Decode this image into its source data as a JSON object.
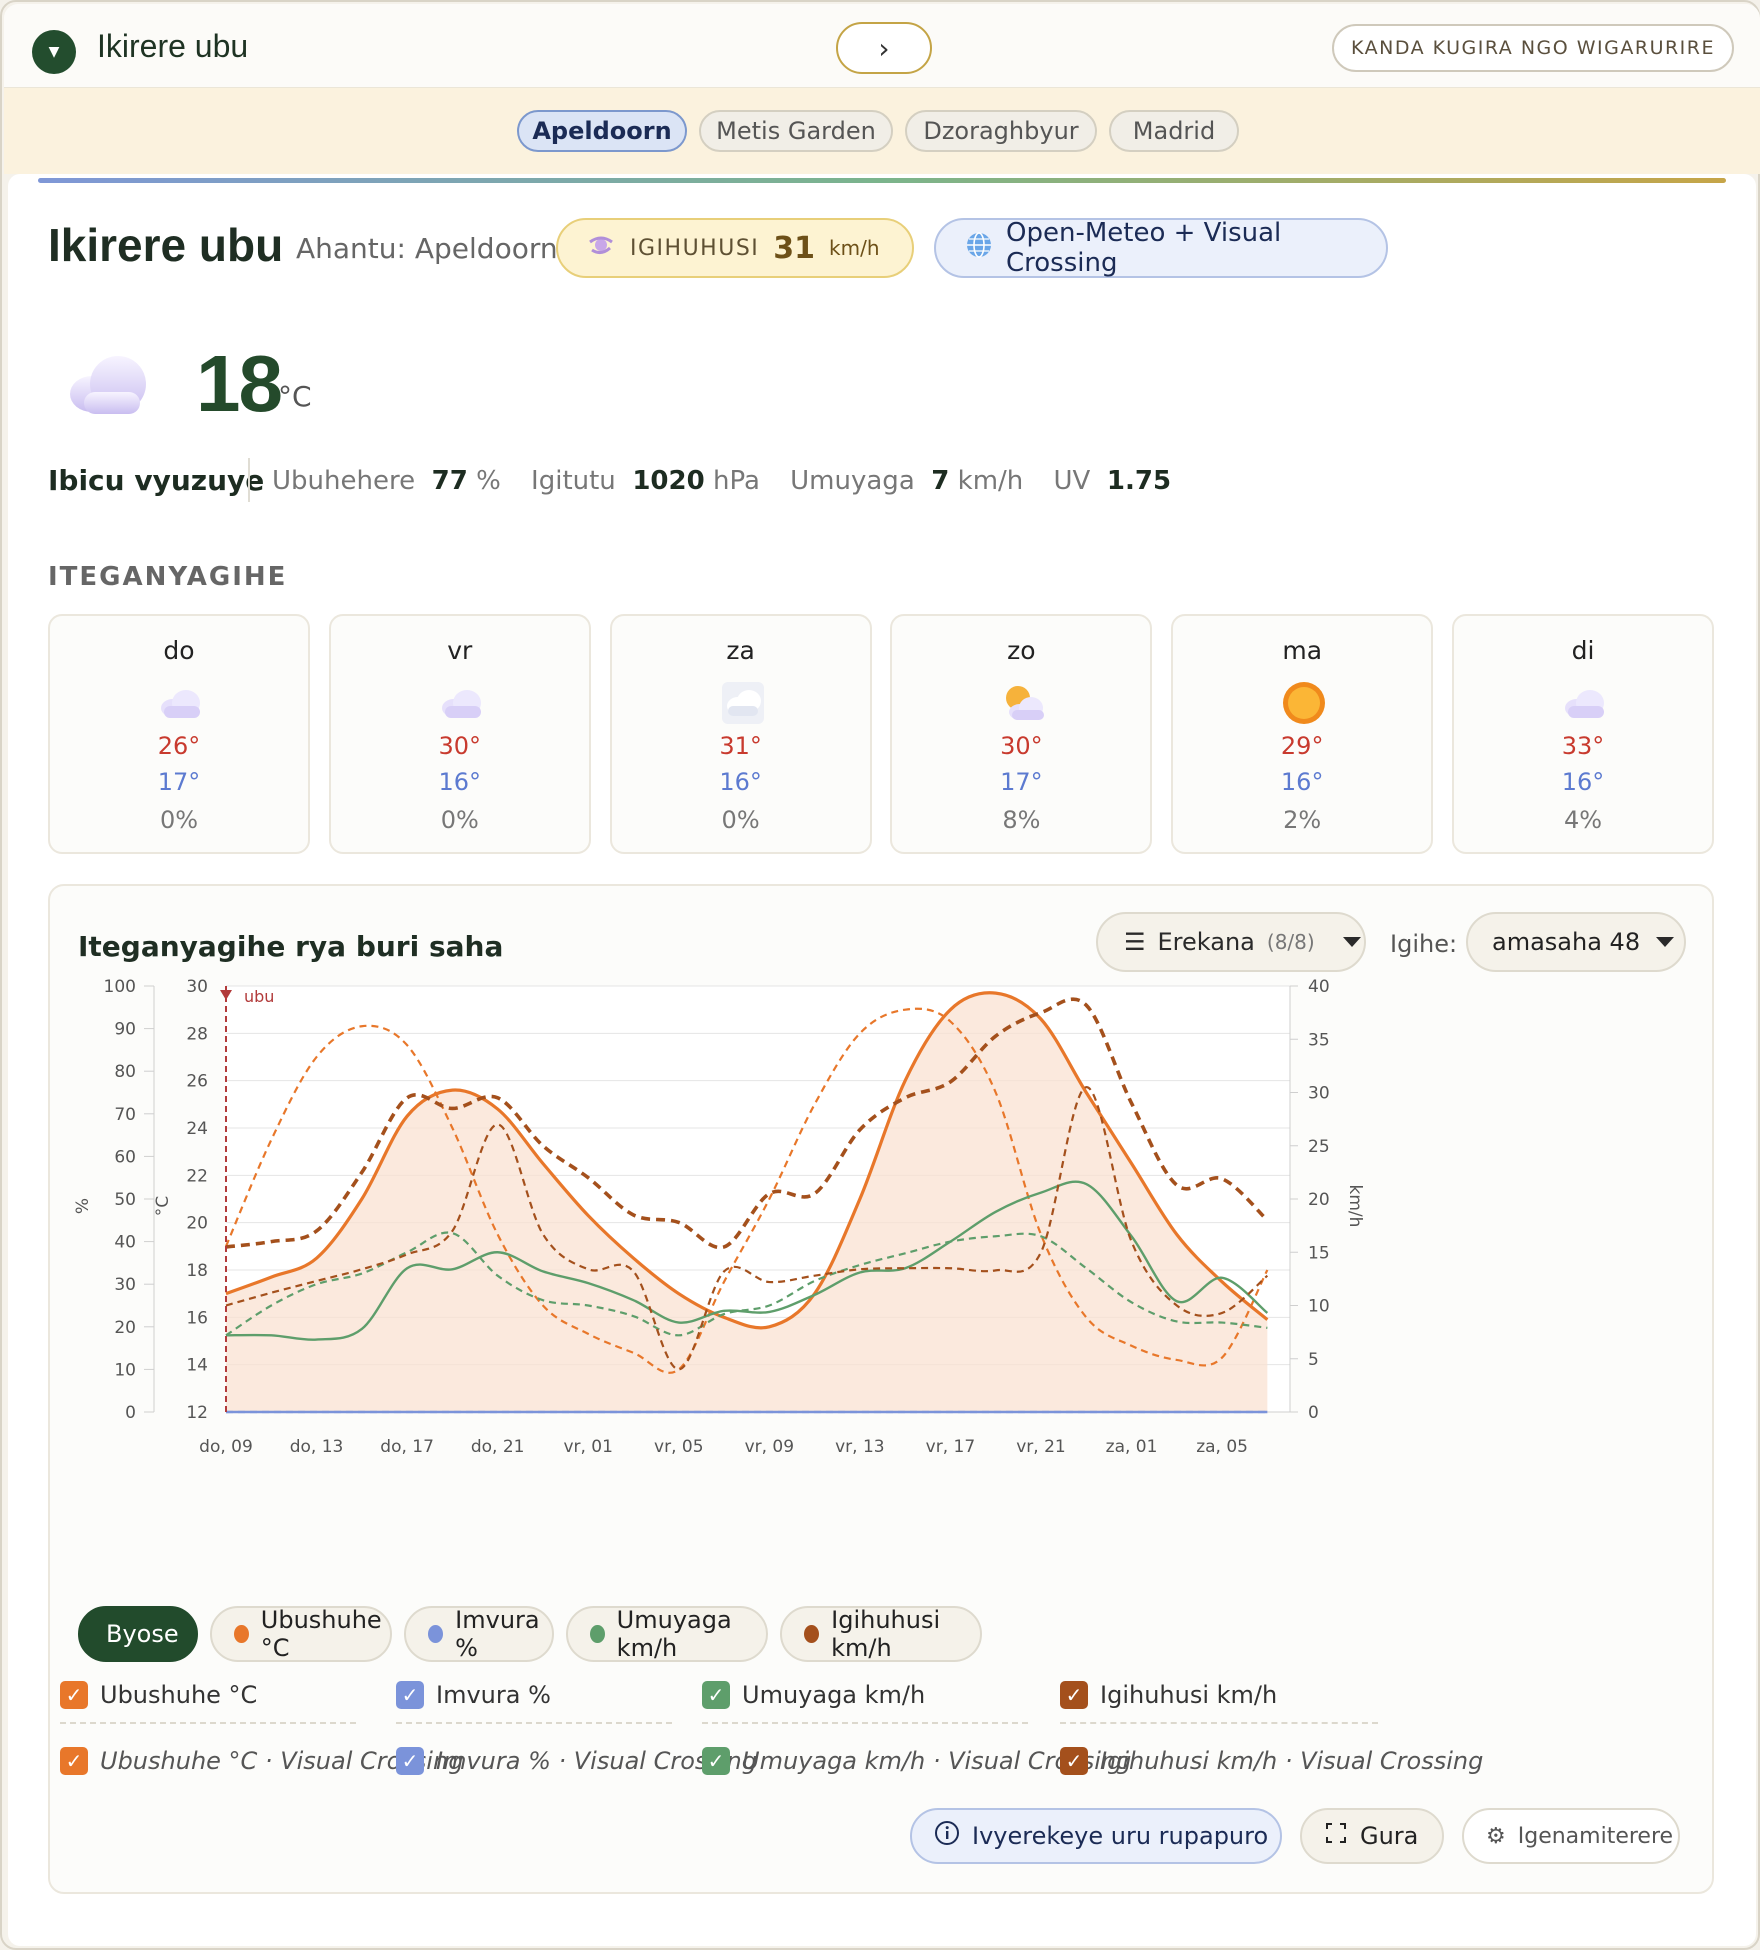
{
  "header": {
    "title": "Ikirere ubu",
    "next_glyph": "›",
    "right_button": "KANDA KUGIRA NGO WIGARURIRE"
  },
  "cities": [
    "Apeldoorn",
    "Metis Garden",
    "Dzoraghbyur",
    "Madrid"
  ],
  "current": {
    "title": "Ikirere ubu",
    "location": "Ahantu: Apeldoorn",
    "gust_label": "IGIHUHUSI",
    "gust_value": "31",
    "gust_unit": "km/h",
    "source": "Open-Meteo + Visual Crossing",
    "temp": "18",
    "temp_unit": "°C",
    "condition": "Ibicu vyuzuye",
    "stats": {
      "humidity_label": "Ubuhehere",
      "humidity_value": "77",
      "humidity_unit": "%",
      "pressure_label": "Igitutu",
      "pressure_value": "1020",
      "pressure_unit": "hPa",
      "wind_label": "Umuyaga",
      "wind_value": "7",
      "wind_unit": "km/h",
      "uv_label": "UV",
      "uv_value": "1.75"
    }
  },
  "forecast": {
    "heading": "ITEGANYAGIHE",
    "days": [
      {
        "day": "do",
        "icon": "cloud",
        "hi": "26°",
        "lo": "17°",
        "precip": "0%"
      },
      {
        "day": "vr",
        "icon": "cloud",
        "hi": "30°",
        "lo": "16°",
        "precip": "0%"
      },
      {
        "day": "za",
        "icon": "fog",
        "hi": "31°",
        "lo": "16°",
        "precip": "0%"
      },
      {
        "day": "zo",
        "icon": "sun-behind-cloud",
        "hi": "30°",
        "lo": "17°",
        "precip": "8%"
      },
      {
        "day": "ma",
        "icon": "sun",
        "hi": "29°",
        "lo": "16°",
        "precip": "2%"
      },
      {
        "day": "di",
        "icon": "cloud",
        "hi": "33°",
        "lo": "16°",
        "precip": "4%"
      }
    ]
  },
  "hourly": {
    "title": "Iteganyagihe rya buri saha",
    "filter_label": "Erekana",
    "filter_count": "(8/8)",
    "range_label": "Igihe:",
    "range_value": "amasaha 48",
    "chips": {
      "all": "Byose",
      "temp": "Ubushuhe °C",
      "rain": "Imvura %",
      "wind": "Umuyaga km/h",
      "gust": "Igihuhusi km/h"
    },
    "checks": {
      "temp": "Ubushuhe °C",
      "rain": "Imvura %",
      "wind": "Umuyaga km/h",
      "gust": "Igihuhusi km/h",
      "temp_vc": "Ubushuhe °C · Visual Crossing",
      "rain_vc": "Imvura % · Visual Crossing",
      "wind_vc": "Umuyaga km/h · Visual Crossing",
      "gust_vc": "Igihuhusi km/h · Visual Crossing"
    },
    "buttons": {
      "fullpage": "Ivyerekeye uru rupapuro",
      "fullscreen": "Gura",
      "settings": "Igenamiterere"
    }
  },
  "colors": {
    "temp": "#e8772a",
    "rain": "#7b93da",
    "wind": "#5e9e6b",
    "gust": "#a4501c",
    "accent": "#224b2c"
  },
  "chart_data": {
    "type": "line",
    "now_marker": "ubu",
    "x_ticks": [
      "do, 09",
      "do, 13",
      "do, 17",
      "do, 21",
      "vr, 01",
      "vr, 05",
      "vr, 09",
      "vr, 13",
      "vr, 17",
      "vr, 21",
      "za, 01",
      "za, 05"
    ],
    "axes": {
      "percent": {
        "label": "%",
        "ticks": [
          0,
          10,
          20,
          30,
          40,
          50,
          60,
          70,
          80,
          90,
          100
        ],
        "range": [
          0,
          100
        ]
      },
      "celsius": {
        "label": "°C",
        "ticks": [
          12,
          14,
          16,
          18,
          20,
          22,
          24,
          26,
          28,
          30
        ],
        "range": [
          12,
          30
        ]
      },
      "kmh": {
        "label": "km/h",
        "ticks": [
          0,
          5,
          10,
          15,
          20,
          25,
          30,
          35,
          40
        ],
        "range": [
          0,
          40
        ]
      }
    },
    "hours": [
      0,
      2,
      4,
      6,
      8,
      10,
      12,
      14,
      16,
      18,
      20,
      22,
      24,
      26,
      28,
      30,
      32,
      34,
      36,
      38,
      40,
      42,
      44,
      46
    ],
    "series": [
      {
        "name": "Ubushuhe °C",
        "axis": "celsius",
        "style": "solid",
        "fill": true,
        "values": [
          17.0,
          17.7,
          18.5,
          21.0,
          24.5,
          25.6,
          24.8,
          22.5,
          20.3,
          18.5,
          17.0,
          16.0,
          15.6,
          17.0,
          21.0,
          26.0,
          29.0,
          29.7,
          28.6,
          25.5,
          22.5,
          19.5,
          17.5,
          15.9
        ]
      },
      {
        "name": "Ubushuhe °C · Visual Crossing",
        "axis": "celsius",
        "style": "dashed",
        "values": [
          19.0,
          23.5,
          27.0,
          28.3,
          27.5,
          24.0,
          19.5,
          16.5,
          15.3,
          14.5,
          13.8,
          17.5,
          21.0,
          25.0,
          28.0,
          29.0,
          28.5,
          25.5,
          19.5,
          16.0,
          14.8,
          14.2,
          14.3,
          18.0
        ]
      },
      {
        "name": "Imvura %",
        "axis": "percent",
        "style": "solid",
        "values": [
          0,
          0,
          0,
          0,
          0,
          0,
          0,
          0,
          0,
          0,
          0,
          0,
          0,
          0,
          0,
          0,
          0,
          0,
          0,
          0,
          0,
          0,
          0,
          0
        ]
      },
      {
        "name": "Imvura % · Visual Crossing",
        "axis": "percent",
        "style": "dashed",
        "values": [
          0,
          0,
          0,
          0,
          0,
          0,
          0,
          0,
          0,
          0,
          0,
          0,
          0,
          0,
          0,
          0,
          0,
          0,
          0,
          0,
          0,
          0,
          0,
          0
        ]
      },
      {
        "name": "Umuyaga km/h",
        "axis": "kmh",
        "style": "solid",
        "values": [
          7.2,
          7.2,
          6.8,
          7.8,
          13.5,
          13.4,
          15.0,
          13.2,
          12.1,
          10.5,
          8.4,
          9.5,
          9.4,
          11.0,
          13.1,
          13.5,
          16.0,
          18.8,
          20.6,
          21.4,
          16.5,
          10.4,
          12.6,
          9.3
        ]
      },
      {
        "name": "Umuyaga km/h · Visual Crossing",
        "axis": "kmh",
        "style": "dashed",
        "values": [
          7.2,
          10.0,
          12.0,
          13.0,
          15.0,
          16.8,
          12.8,
          10.5,
          10.0,
          9.0,
          7.2,
          9.2,
          10.0,
          12.3,
          13.8,
          14.9,
          16.0,
          16.5,
          16.5,
          13.5,
          10.3,
          8.5,
          8.4,
          7.9
        ]
      },
      {
        "name": "Igihuhusi km/h",
        "axis": "kmh",
        "style": "dashed",
        "values": [
          15.5,
          16.0,
          17.0,
          22.5,
          29.5,
          28.5,
          29.5,
          25.0,
          22.0,
          18.5,
          17.8,
          15.5,
          20.5,
          20.5,
          26.5,
          29.5,
          31.0,
          35.3,
          37.5,
          38.2,
          29.0,
          21.3,
          21.9,
          18.0
        ]
      },
      {
        "name": "Igihuhusi km/h · Visual Crossing",
        "axis": "kmh",
        "style": "dashed",
        "values": [
          10.0,
          11.2,
          12.3,
          13.4,
          14.8,
          17.0,
          27.0,
          16.7,
          13.4,
          13.2,
          4.0,
          13.2,
          12.2,
          12.8,
          13.4,
          13.5,
          13.5,
          13.3,
          15.0,
          30.5,
          16.0,
          10.0,
          9.3,
          12.8
        ]
      }
    ]
  }
}
